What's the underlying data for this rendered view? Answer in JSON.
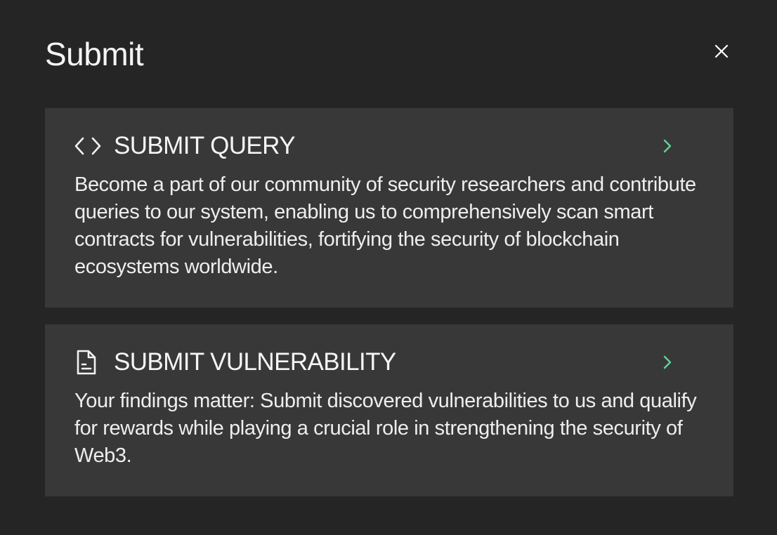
{
  "modal": {
    "title": "Submit",
    "close_icon": "close-icon"
  },
  "options": [
    {
      "icon": "code-icon",
      "title": "SUBMIT QUERY",
      "description": "Become a part of our community of security researchers and contribute queries to our system, enabling us to comprehensively scan smart contracts for vulnerabilities, fortifying the security of blockchain ecosystems worldwide.",
      "chevron_icon": "chevron-right-icon"
    },
    {
      "icon": "document-icon",
      "title": "SUBMIT VULNERABILITY",
      "description": "Your findings matter: Submit discovered vulnerabilities to us and qualify for rewards while playing a crucial role in strengthening the security of Web3.",
      "chevron_icon": "chevron-right-icon"
    }
  ],
  "colors": {
    "background": "#252525",
    "card": "#383838",
    "text": "#f5f5f5",
    "accent": "#5fd39a"
  }
}
